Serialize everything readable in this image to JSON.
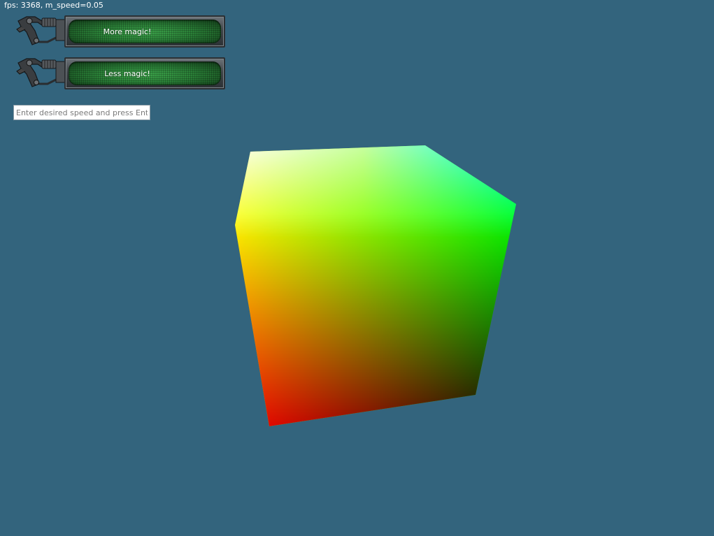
{
  "hud": {
    "fps_text": "fps: 3368, m_speed=0.05"
  },
  "buttons": {
    "more_label": "More magic!",
    "less_label": "Less magic!"
  },
  "speed_input": {
    "value": "",
    "placeholder": "Enter desired speed and press Enter"
  },
  "colors": {
    "background": "#33647d",
    "button_glow": "#3da74c",
    "cube_corner_white": "#ffffff",
    "cube_corner_cyan": "#00ffff",
    "cube_corner_green": "#00ff00",
    "cube_corner_yellow": "#ffff00",
    "cube_corner_red": "#ff0000",
    "cube_corner_black": "#000000"
  },
  "icons": [
    "robot-claw-icon"
  ]
}
